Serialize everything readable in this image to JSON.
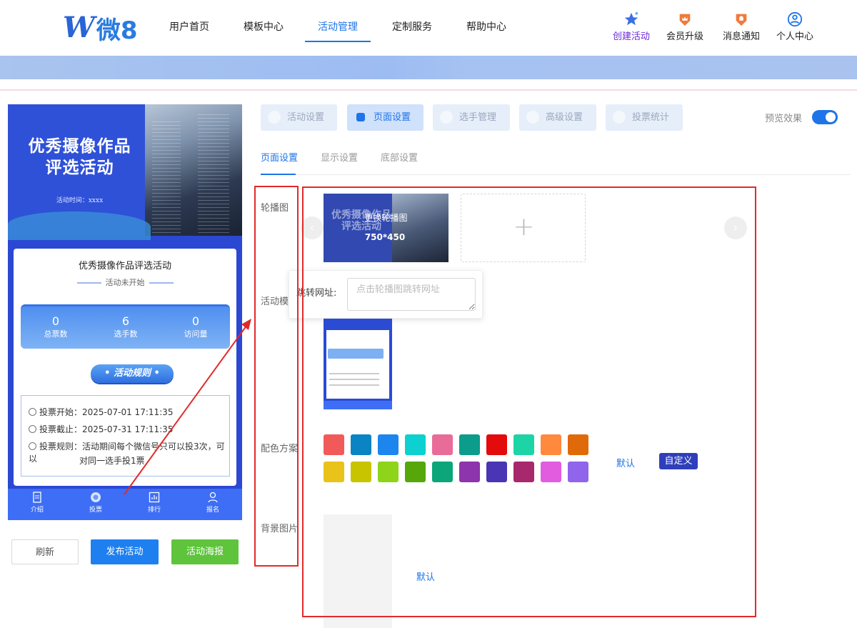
{
  "brand": {
    "logo_mark": "W",
    "logo_text": "微8"
  },
  "nav": {
    "items": [
      {
        "label": "用户首页",
        "active": false
      },
      {
        "label": "模板中心",
        "active": false
      },
      {
        "label": "活动管理",
        "active": true
      },
      {
        "label": "定制服务",
        "active": false
      },
      {
        "label": "帮助中心",
        "active": false
      }
    ],
    "right": [
      {
        "label": "创建活动",
        "icon": "star-icon",
        "color": "#6c2bd9"
      },
      {
        "label": "会员升级",
        "icon": "crown-badge-icon",
        "color": "#f07a3c"
      },
      {
        "label": "消息通知",
        "icon": "bell-badge-icon",
        "color": "#f07a3c"
      },
      {
        "label": "个人中心",
        "icon": "user-circle-icon",
        "color": "#1e74e8"
      }
    ]
  },
  "preview": {
    "hero_title": "优秀摄像作品评选活动",
    "hero_date": "活动时间：xxxx",
    "card_title": "优秀摄像作品评选活动",
    "status": "活动未开始",
    "stats": [
      {
        "value": "0",
        "label": "总票数"
      },
      {
        "value": "6",
        "label": "选手数"
      },
      {
        "value": "0",
        "label": "访问量"
      }
    ],
    "rules_button": "• 活动规则 •",
    "rules": {
      "start": "投票开始：2025-07-01 17:11:35",
      "end": "投票截止：2025-07-31 17:11:35",
      "rule_line1": "投票规则：活动期间每个微信号只可以投3次，可以",
      "rule_line2": "对同一选手投1票"
    },
    "tabs": [
      {
        "label": "介绍",
        "icon": "document-icon"
      },
      {
        "label": "投票",
        "icon": "vote-icon"
      },
      {
        "label": "排行",
        "icon": "chart-icon"
      },
      {
        "label": "报名",
        "icon": "person-icon"
      }
    ]
  },
  "actions": {
    "refresh": "刷新",
    "publish": "发布活动",
    "poster": "活动海报"
  },
  "settings_tabs": [
    {
      "label": "活动设置",
      "active": false
    },
    {
      "label": "页面设置",
      "active": true
    },
    {
      "label": "选手管理",
      "active": false
    },
    {
      "label": "高级设置",
      "active": false
    },
    {
      "label": "投票统计",
      "active": false
    }
  ],
  "preview_toggle": {
    "label": "预览效果",
    "on": true
  },
  "subtabs": [
    {
      "label": "页面设置",
      "active": true
    },
    {
      "label": "显示设置",
      "active": false
    },
    {
      "label": "底部设置",
      "active": false
    }
  ],
  "form": {
    "carousel_label": "轮播图",
    "carousel_ghost": "优秀摄像作品评选活动",
    "carousel_change": "更换轮播图",
    "carousel_size": "750*450",
    "link_label": "跳转网址:",
    "link_placeholder": "点击轮播图跳转网址",
    "template_label": "活动模",
    "color_label": "配色方案",
    "colors": [
      "#f25a5a",
      "#0a84c2",
      "#1c86ee",
      "#0dd0d0",
      "#e96c98",
      "#0b9c8c",
      "#e30b0b",
      "#1dd4a6",
      "#ff8a3d",
      "#e06a0a",
      "#e9c21a",
      "#c8c400",
      "#8ed41a",
      "#55a70a",
      "#0ca67a",
      "#8c35ac",
      "#4a36b4",
      "#a8286e",
      "#e25ce0",
      "#9164ec"
    ],
    "default_text": "默认",
    "custom_text": "自定义",
    "bg_label": "背景图片",
    "bg_default": "默认"
  }
}
